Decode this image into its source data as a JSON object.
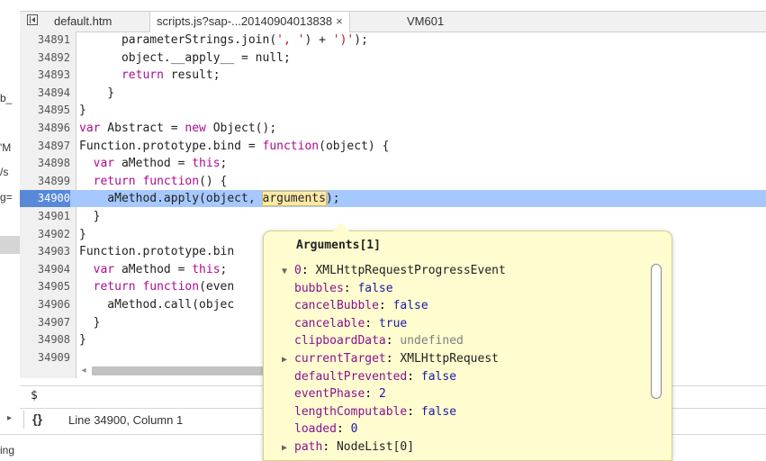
{
  "left_fragments": [
    "b_",
    "'M",
    "/s",
    "g=",
    "ing"
  ],
  "tabs": [
    {
      "label": "default.htm",
      "active": false
    },
    {
      "label": "scripts.js?sap-...20140904013838",
      "active": true,
      "close": "×"
    },
    {
      "label": "VM601",
      "active": false
    }
  ],
  "code_lines": [
    {
      "num": "34891",
      "parts": [
        {
          "t": "      parameterStrings.join(",
          "c": ""
        },
        {
          "t": "', '",
          "c": "str"
        },
        {
          "t": ") + ",
          "c": ""
        },
        {
          "t": "')'",
          "c": "str"
        },
        {
          "t": ");",
          "c": ""
        }
      ]
    },
    {
      "num": "34892",
      "parts": [
        {
          "t": "      object.__apply__ = null;",
          "c": ""
        }
      ]
    },
    {
      "num": "34893",
      "parts": [
        {
          "t": "      ",
          "c": ""
        },
        {
          "t": "return",
          "c": "kw"
        },
        {
          "t": " result;",
          "c": ""
        }
      ]
    },
    {
      "num": "34894",
      "parts": [
        {
          "t": "    }",
          "c": ""
        }
      ]
    },
    {
      "num": "34895",
      "parts": [
        {
          "t": "}",
          "c": ""
        }
      ]
    },
    {
      "num": "34896",
      "parts": [
        {
          "t": "var",
          "c": "kw"
        },
        {
          "t": " Abstract = ",
          "c": ""
        },
        {
          "t": "new",
          "c": "kw"
        },
        {
          "t": " Object();",
          "c": ""
        }
      ]
    },
    {
      "num": "34897",
      "parts": [
        {
          "t": "Function.prototype.bind = ",
          "c": ""
        },
        {
          "t": "function",
          "c": "kw"
        },
        {
          "t": "(object) {",
          "c": ""
        }
      ]
    },
    {
      "num": "34898",
      "parts": [
        {
          "t": "  ",
          "c": ""
        },
        {
          "t": "var",
          "c": "kw"
        },
        {
          "t": " aMethod = ",
          "c": ""
        },
        {
          "t": "this",
          "c": "kw"
        },
        {
          "t": ";",
          "c": ""
        }
      ]
    },
    {
      "num": "34899",
      "parts": [
        {
          "t": "  ",
          "c": ""
        },
        {
          "t": "return",
          "c": "kw"
        },
        {
          "t": " ",
          "c": ""
        },
        {
          "t": "function",
          "c": "kw"
        },
        {
          "t": "() {",
          "c": ""
        }
      ]
    },
    {
      "num": "34900",
      "exec": true,
      "parts": [
        {
          "t": "    aMethod.apply(object, ",
          "c": ""
        },
        {
          "t": "arguments",
          "c": "hl"
        },
        {
          "t": ");",
          "c": ""
        }
      ]
    },
    {
      "num": "34901",
      "parts": [
        {
          "t": "  }",
          "c": ""
        }
      ]
    },
    {
      "num": "34902",
      "parts": [
        {
          "t": "}",
          "c": ""
        }
      ]
    },
    {
      "num": "34903",
      "parts": [
        {
          "t": "Function.prototype.bin",
          "c": ""
        }
      ]
    },
    {
      "num": "34904",
      "parts": [
        {
          "t": "  ",
          "c": ""
        },
        {
          "t": "var",
          "c": "kw"
        },
        {
          "t": " aMethod = ",
          "c": ""
        },
        {
          "t": "this",
          "c": "kw"
        },
        {
          "t": ";",
          "c": ""
        }
      ]
    },
    {
      "num": "34905",
      "parts": [
        {
          "t": "  ",
          "c": ""
        },
        {
          "t": "return",
          "c": "kw"
        },
        {
          "t": " ",
          "c": ""
        },
        {
          "t": "function",
          "c": "kw"
        },
        {
          "t": "(even",
          "c": ""
        }
      ]
    },
    {
      "num": "34906",
      "parts": [
        {
          "t": "    aMethod.call(objec",
          "c": ""
        }
      ]
    },
    {
      "num": "34907",
      "parts": [
        {
          "t": "  }",
          "c": ""
        }
      ]
    },
    {
      "num": "34908",
      "parts": [
        {
          "t": "}",
          "c": ""
        }
      ]
    },
    {
      "num": "34909",
      "parts": []
    }
  ],
  "console": {
    "prompt": "$"
  },
  "status": {
    "braces": "{}",
    "position": "Line 34900, Column 1"
  },
  "popover": {
    "title": "Arguments[1]",
    "props": [
      {
        "expander": "expanded",
        "key": "0",
        "value": "XMLHttpRequestProgressEvent",
        "vclass": "obj",
        "indent": 0
      },
      {
        "expander": "",
        "key": "bubbles",
        "value": "false",
        "vclass": "bool",
        "indent": 1
      },
      {
        "expander": "",
        "key": "cancelBubble",
        "value": "false",
        "vclass": "bool",
        "indent": 1
      },
      {
        "expander": "",
        "key": "cancelable",
        "value": "true",
        "vclass": "bool",
        "indent": 1
      },
      {
        "expander": "",
        "key": "clipboardData",
        "value": "undefined",
        "vclass": "undef",
        "indent": 1
      },
      {
        "expander": "collapsed",
        "key": "currentTarget",
        "value": "XMLHttpRequest",
        "vclass": "obj",
        "indent": 1
      },
      {
        "expander": "",
        "key": "defaultPrevented",
        "value": "false",
        "vclass": "bool",
        "indent": 1
      },
      {
        "expander": "",
        "key": "eventPhase",
        "value": "2",
        "vclass": "num",
        "indent": 1
      },
      {
        "expander": "",
        "key": "lengthComputable",
        "value": "false",
        "vclass": "bool",
        "indent": 1
      },
      {
        "expander": "",
        "key": "loaded",
        "value": "0",
        "vclass": "num",
        "indent": 1
      },
      {
        "expander": "collapsed",
        "key": "path",
        "value": "NodeList[0]",
        "vclass": "obj",
        "indent": 1
      }
    ]
  }
}
